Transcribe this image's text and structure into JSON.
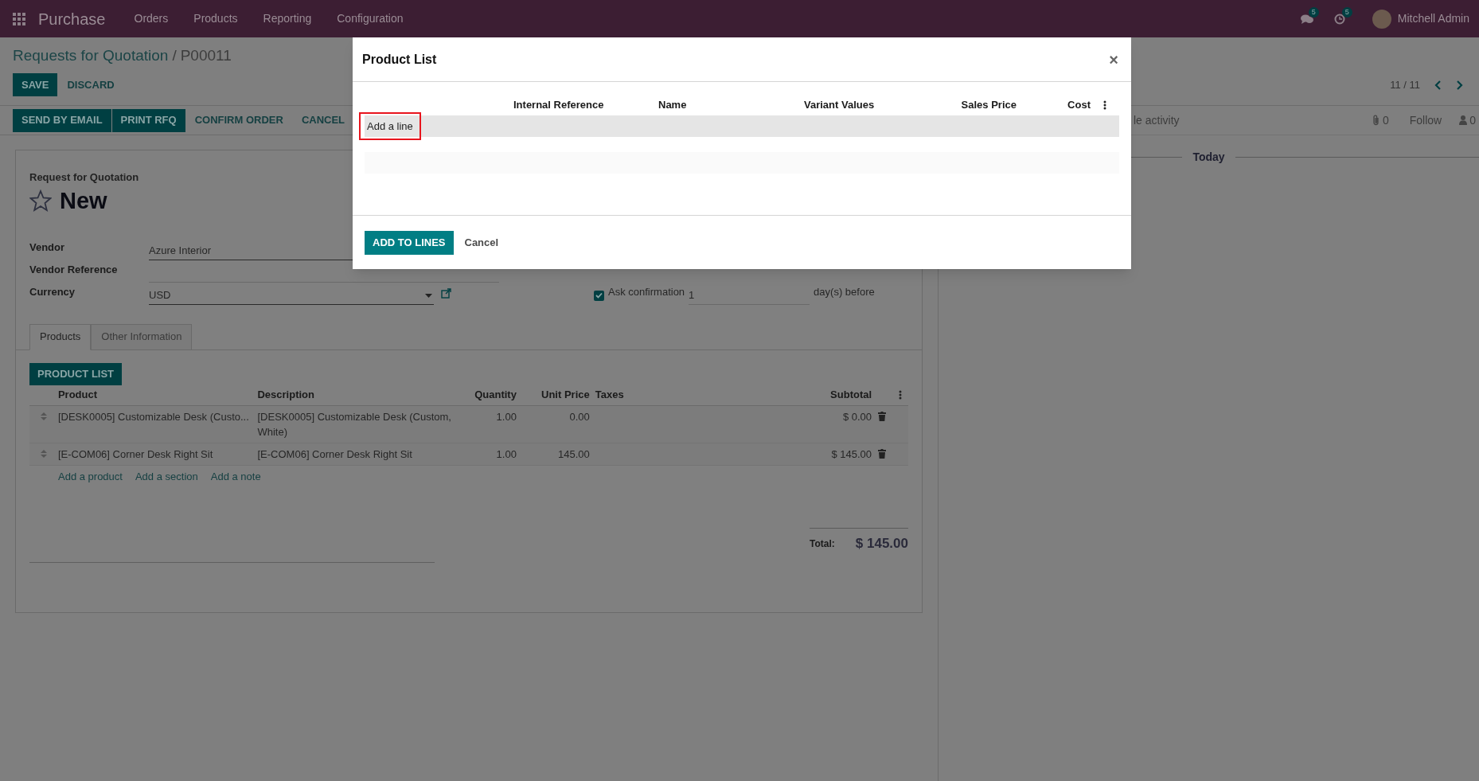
{
  "navbar": {
    "app": "Purchase",
    "menus": [
      "Orders",
      "Products",
      "Reporting",
      "Configuration"
    ],
    "messages_count": "5",
    "activities_count": "5",
    "user": "Mitchell Admin"
  },
  "breadcrumb": {
    "parent": "Requests for Quotation",
    "separator": "/",
    "current": "P00011"
  },
  "edit_buttons": [
    {
      "label": "SAVE",
      "kind": "primary"
    },
    {
      "label": "DISCARD",
      "kind": "link"
    }
  ],
  "pager": "11 / 11",
  "action_buttons": [
    {
      "label": "SEND BY EMAIL",
      "kind": "primary"
    },
    {
      "label": "PRINT RFQ",
      "kind": "primary"
    },
    {
      "label": "CONFIRM ORDER",
      "kind": "link"
    },
    {
      "label": "CANCEL",
      "kind": "link"
    }
  ],
  "chatter": {
    "toolbar_text": "le activity",
    "attachments": "0",
    "follow": "Follow",
    "followers": "0",
    "date_separator": "Today"
  },
  "form": {
    "subtitle": "Request for Quotation",
    "title": "New",
    "starred": false,
    "fields": [
      {
        "label": "Vendor",
        "value": "Azure Interior",
        "kind": "text"
      },
      {
        "label": "Vendor Reference",
        "kind": "text"
      },
      {
        "label": "Currency",
        "value": "USD",
        "kind": "select"
      }
    ],
    "ask_confirmation": {
      "label": "Ask confirmation",
      "checked": true,
      "value": "1",
      "suffix": "day(s) before"
    },
    "tabs": [
      {
        "label": "Products",
        "selected": true
      },
      {
        "label": "Other Information",
        "selected": false
      }
    ],
    "product_list_button": "PRODUCT LIST",
    "lines": {
      "columns": [
        "Product",
        "Description",
        "Quantity",
        "Unit Price",
        "Taxes",
        "Subtotal"
      ],
      "rows": [
        {
          "product": "[DESK0005] Customizable Desk (Custo...",
          "description": "[DESK0005] Customizable Desk (Custom, White)",
          "quantity": "1.00",
          "unit_price": "0.00",
          "subtotal": "$ 0.00"
        },
        {
          "product": "[E-COM06] Corner Desk Right Sit",
          "description": "[E-COM06] Corner Desk Right Sit",
          "quantity": "1.00",
          "unit_price": "145.00",
          "subtotal": "$ 145.00"
        }
      ],
      "add_links": [
        "Add a product",
        "Add a section",
        "Add a note"
      ]
    },
    "total": {
      "label": "Total:",
      "value": "$ 145.00"
    }
  },
  "modal": {
    "title": "Product List",
    "close": "×",
    "columns": [
      "Internal Reference",
      "Name",
      "Variant Values",
      "Sales Price",
      "Cost"
    ],
    "add_line": "Add a line",
    "buttons": [
      {
        "label": "ADD TO LINES",
        "kind": "primary"
      },
      {
        "label": "Cancel",
        "kind": "link"
      }
    ]
  }
}
